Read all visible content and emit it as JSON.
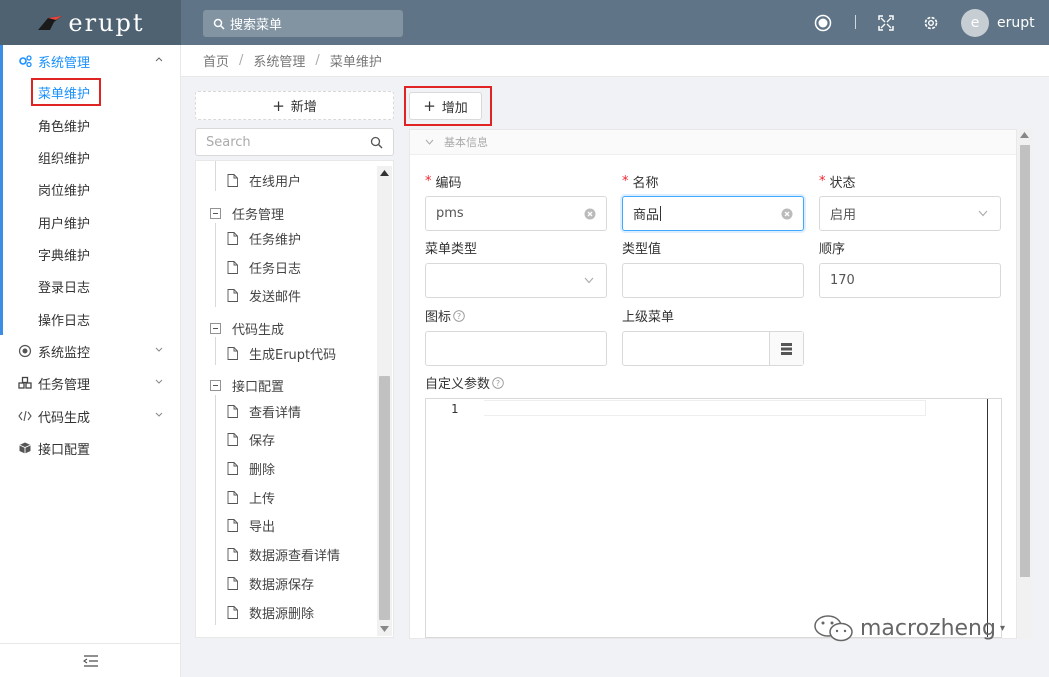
{
  "app": {
    "logo_text": "erupt",
    "brand_color": "#5f7587",
    "accent": "#1890ff"
  },
  "header": {
    "search_placeholder": "搜索菜单",
    "username": "erupt",
    "avatar_initial": "e",
    "icons": [
      "record-icon",
      "fullscreen-icon",
      "settings-icon"
    ]
  },
  "sidebar": {
    "groups": [
      {
        "label": "系统管理",
        "icon": "gears-icon",
        "expanded": true,
        "items": [
          "菜单维护",
          "角色维护",
          "组织维护",
          "岗位维护",
          "用户维护",
          "字典维护",
          "登录日志",
          "操作日志"
        ]
      },
      {
        "label": "系统监控",
        "icon": "monitor-icon"
      },
      {
        "label": "任务管理",
        "icon": "cubes-icon"
      },
      {
        "label": "代码生成",
        "icon": "code-icon"
      },
      {
        "label": "接口配置",
        "icon": "box-icon"
      }
    ],
    "active_item": "菜单维护"
  },
  "breadcrumb": [
    "首页",
    "系统管理",
    "菜单维护"
  ],
  "tree": {
    "new_button": "新增",
    "search_placeholder": "Search",
    "nodes": [
      {
        "label": "在线用户",
        "type": "leaf"
      },
      {
        "label": "任务管理",
        "type": "folder"
      },
      {
        "label": "任务维护",
        "type": "leaf"
      },
      {
        "label": "任务日志",
        "type": "leaf"
      },
      {
        "label": "发送邮件",
        "type": "leaf"
      },
      {
        "label": "代码生成",
        "type": "folder"
      },
      {
        "label": "生成Erupt代码",
        "type": "leaf"
      },
      {
        "label": "接口配置",
        "type": "folder"
      },
      {
        "label": "查看详情",
        "type": "leaf"
      },
      {
        "label": "保存",
        "type": "leaf"
      },
      {
        "label": "删除",
        "type": "leaf"
      },
      {
        "label": "上传",
        "type": "leaf"
      },
      {
        "label": "导出",
        "type": "leaf"
      },
      {
        "label": "数据源查看详情",
        "type": "leaf"
      },
      {
        "label": "数据源保存",
        "type": "leaf"
      },
      {
        "label": "数据源删除",
        "type": "leaf"
      }
    ]
  },
  "form": {
    "add_button": "增加",
    "section_title": "基本信息",
    "fields": {
      "code": {
        "label": "编码",
        "required": true,
        "value": "pms"
      },
      "name": {
        "label": "名称",
        "required": true,
        "value": "商品"
      },
      "status": {
        "label": "状态",
        "required": true,
        "value": "启用"
      },
      "menu_type": {
        "label": "菜单类型",
        "value": ""
      },
      "type_value": {
        "label": "类型值",
        "value": ""
      },
      "order": {
        "label": "顺序",
        "value": "170"
      },
      "icon": {
        "label": "图标",
        "value": ""
      },
      "parent_menu": {
        "label": "上级菜单",
        "value": ""
      },
      "custom_params": {
        "label": "自定义参数",
        "line_number": "1"
      }
    }
  },
  "watermark": {
    "text": "macrozheng"
  }
}
